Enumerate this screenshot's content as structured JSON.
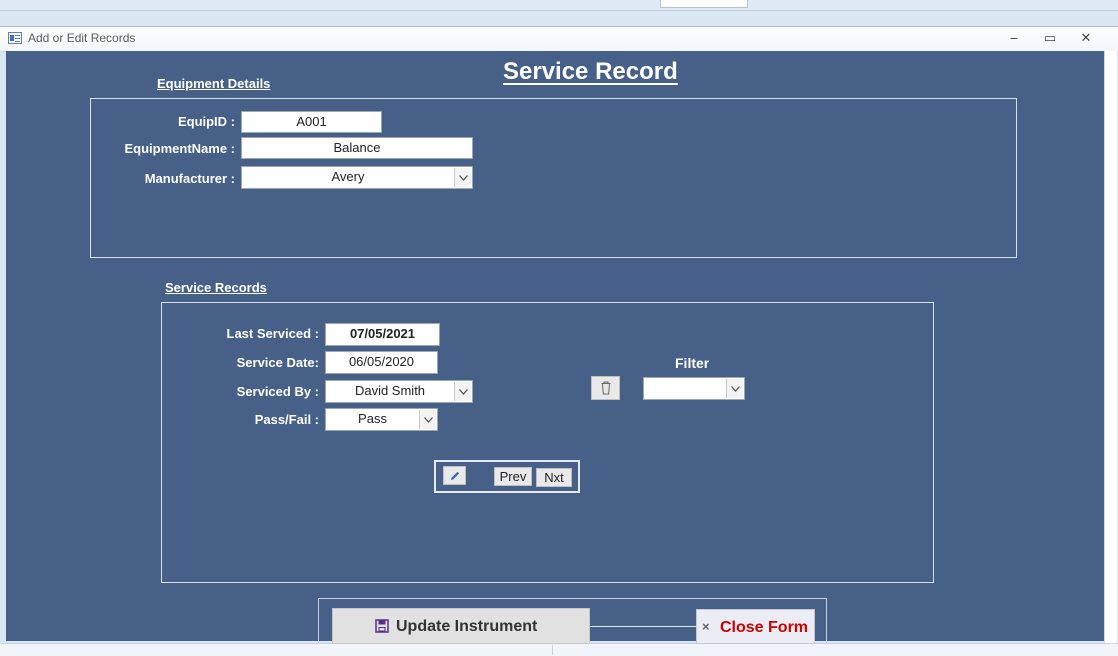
{
  "window": {
    "title": "Add or Edit Records",
    "minimize_glyph": "‒",
    "maximize_glyph": "▭",
    "close_glyph": "✕"
  },
  "form": {
    "title": "Service Record",
    "equipment_section": {
      "label": "Equipment Details",
      "equip_id_label": "EquipID :",
      "equip_id_value": "A001",
      "equipment_name_label": "EquipmentName :",
      "equipment_name_value": "Balance",
      "manufacturer_label": "Manufacturer :",
      "manufacturer_value": "Avery"
    },
    "service_section": {
      "label": "Service Records",
      "last_serviced_label": "Last Serviced :",
      "last_serviced_value": "07/05/2021",
      "service_date_label": "Service Date:",
      "service_date_value": "06/05/2020",
      "serviced_by_label": "Serviced By :",
      "serviced_by_value": "David Smith",
      "pass_fail_label": "Pass/Fail :",
      "pass_fail_value": "Pass",
      "filter_label": "Filter",
      "filter_value": "",
      "prev_label": "Prev",
      "next_label": "Nxt"
    },
    "buttons": {
      "update_label": "Update Instrument",
      "close_label": "Close Form",
      "close_glyph": "×"
    }
  },
  "icons": {
    "window_icon": "form-icon",
    "edit_icon": "pencil-icon",
    "clear_filter_icon": "trash-icon",
    "update_icon": "save-icon",
    "dropdown_icon": "chevron-down-icon"
  },
  "colors": {
    "form_background": "#466088",
    "close_text": "#d00000",
    "label_text": "#ffffff"
  }
}
